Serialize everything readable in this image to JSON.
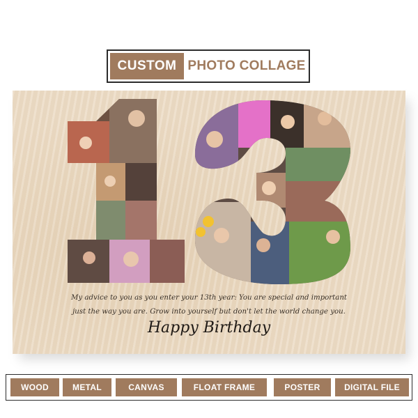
{
  "header": {
    "label_primary": "CUSTOM",
    "label_secondary": "PHOTO COLLAGE"
  },
  "board": {
    "number": "13",
    "message_line1": "My advice to you as you enter your 13th year: You are special and important",
    "message_line2": "just the way you are. Grow into yourself but don't let the world change you.",
    "greeting": "Happy Birthday"
  },
  "options": [
    {
      "label": "WOOD"
    },
    {
      "label": "METAL"
    },
    {
      "label": "CANVAS"
    },
    {
      "label": "FLOAT FRAME"
    },
    {
      "label": "POSTER"
    },
    {
      "label": "DIGITAL FILE"
    }
  ],
  "colors": {
    "accent": "#a07b5e",
    "board": "#ecdcc6",
    "border": "#2b2b2b",
    "text": "#3a3128"
  }
}
